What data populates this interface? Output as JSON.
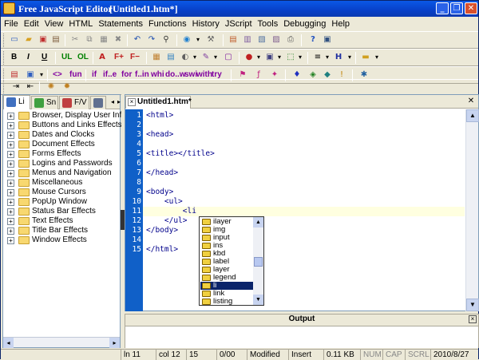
{
  "window": {
    "app_title": "Free JavaScript Editor",
    "doc_title": "[Untitled1.htm*]",
    "min_icon": "minimize-icon",
    "max_icon": "maximize-icon",
    "close_icon": "close-icon"
  },
  "menu": [
    "File",
    "Edit",
    "View",
    "HTML",
    "Statements",
    "Functions",
    "History",
    "JScript",
    "Tools",
    "Debugging",
    "Help"
  ],
  "toolbar_text": {
    "bold": "B",
    "italic": "I",
    "underline": "U",
    "ul": "UL",
    "ol": "OL",
    "font_plus": "F+",
    "font_minus": "F−",
    "tag_arrow": "<>",
    "fun": "fun",
    "if": "if",
    "ife": "if..e",
    "for": "for",
    "fin": "f..in",
    "whi": "whi",
    "dow": "do..w",
    "swi": "swi",
    "with": "with",
    "try": "try"
  },
  "left_tabs": [
    {
      "label": "Li",
      "icon": "library-icon"
    },
    {
      "label": "Sn",
      "icon": "snippet-icon"
    },
    {
      "label": "F/V",
      "icon": "functions-icon"
    },
    {
      "label": "",
      "icon": "stack-icon"
    }
  ],
  "tree": [
    "Browser, Display User Informat",
    "Buttons and Links Effects",
    "Dates and Clocks",
    "Document Effects",
    "Forms Effects",
    "Logins and Passwords",
    "Menus and Navigation",
    "Miscellaneous",
    "Mouse Cursors",
    "PopUp Window",
    "Status Bar Effects",
    "Text Effects",
    "Title Bar Effects",
    "Window Effects"
  ],
  "editor": {
    "tab": "Untitled1.htm*",
    "lines": [
      "<html>",
      "",
      "<head>",
      "",
      "<title></title>",
      "",
      "</head>",
      "",
      "<body>",
      "    <ul>",
      "        <li",
      "    </ul>",
      "</body>",
      "",
      "</html>"
    ],
    "line_numbers": [
      "1",
      "2",
      "3",
      "4",
      "5",
      "6",
      "7",
      "8",
      "9",
      "10",
      "11",
      "12",
      "13",
      "14",
      "15"
    ],
    "current_line": 11
  },
  "autocomplete": {
    "items": [
      "ilayer",
      "img",
      "input",
      "ins",
      "kbd",
      "label",
      "layer",
      "legend",
      "li",
      "link",
      "listing"
    ],
    "selected": "li"
  },
  "output": {
    "title": "Output"
  },
  "status": {
    "ln": "ln 11",
    "col": "col 12",
    "num15": "15",
    "count": "0/00",
    "modified": "Modified",
    "insert": "Insert",
    "size": "0.11 KB",
    "num": "NUM",
    "cap": "CAP",
    "scrl": "SCRL",
    "date": "2010/8/27"
  }
}
